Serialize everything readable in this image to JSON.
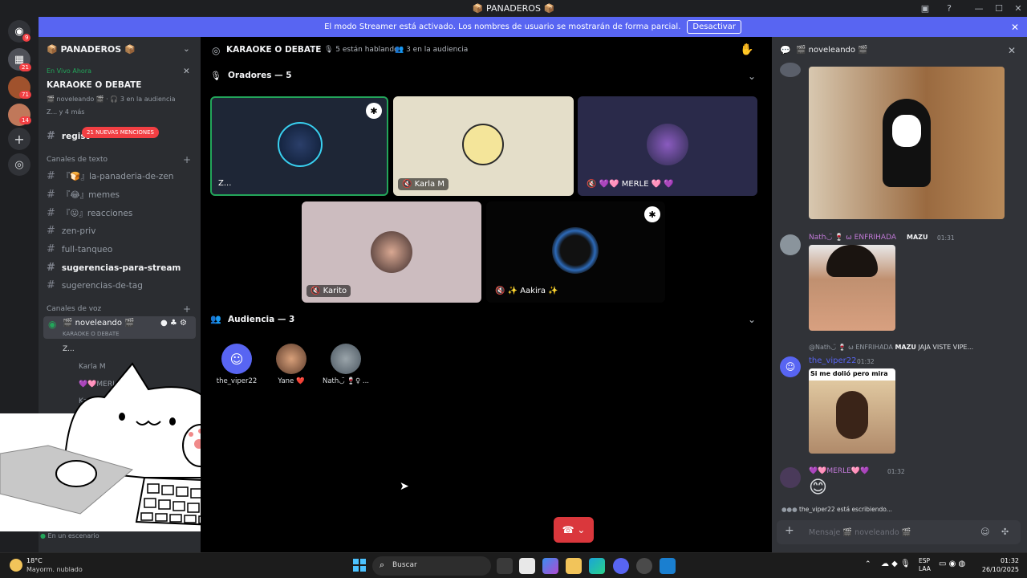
{
  "window": {
    "title": "📦 PANADEROS 📦"
  },
  "banner": {
    "text": "El modo Streamer está activado. Los nombres de usuario se mostrarán de forma parcial.",
    "button": "Desactivar"
  },
  "rail": {
    "badges": [
      "9",
      "21",
      "71",
      "14"
    ]
  },
  "server": {
    "name": "📦 PANADEROS 📦"
  },
  "live": {
    "tag": "En Vivo Ahora",
    "title": "KARAOKE O DEBATE",
    "meta": "🎬 noveleando 🎬 · 🎧 3 en la audiencia",
    "listeners": "Z... y 4 más"
  },
  "sidebar": {
    "registro": "regist",
    "mentions": "21 NUEVAS MENCIONES",
    "text_header": "Canales de texto",
    "text_channels": [
      "『🍞』la-panaderia-de-zen",
      "『😂』memes",
      "『😛』reacciones",
      "zen-priv",
      "full-tanqueo",
      "sugerencias-para-stream",
      "sugerencias-de-tag"
    ],
    "voice_header": "Canales de voz",
    "voice_channel": "🎬 noveleando 🎬",
    "voice_sub": "KARAOKE O DEBATE",
    "voice_members": [
      "Z...",
      "Karla M",
      "💜🩷MERLE",
      "Ka"
    ],
    "footer": "En un escenario"
  },
  "stage": {
    "title": "KARAOKE O DEBATE",
    "speaking": "5 están hablando",
    "audience_count": "3 en la audiencia",
    "speakers_header": "Oradores — 5",
    "speakers": [
      "Z...",
      "Karla M",
      "💜🩷 MERLE 🩷 💜",
      "Karito",
      "✨ Aakira ✨"
    ],
    "audience_header": "Audiencia — 3",
    "audience": [
      "the_viper22",
      "Yane ❤️",
      "Nath◡̈ 🍷♀ ..."
    ]
  },
  "chat": {
    "channel": "🎬 noveleando 🎬",
    "msg1_author": "Nath◡̈ 🍷 ⍵ ENFRIHADA",
    "msg1_tag": "MAZU",
    "msg1_time": "01:31",
    "reply_ref": "@Nath◡̈ 🍷 ⍵ ENFRIHADA",
    "reply_tag": "MAZU",
    "reply_text": "JAJA VISTE VIPE...",
    "msg2_author": "the_viper22",
    "msg2_time": "01:32",
    "msg2_image_text": "Si me dolió pero mira",
    "msg3_author": "💜🩷MERLE🩷💜",
    "msg3_time": "01:32",
    "msg3_emoji": "😊",
    "typing": "the_viper22 está escribiendo...",
    "input_placeholder": "Mensaje 🎬 noveleando 🎬"
  },
  "taskbar": {
    "temp": "18°C",
    "weather": "Mayorm. nublado",
    "search": "Buscar",
    "lang1": "ESP",
    "lang2": "LAA",
    "time": "01:32",
    "date": "26/10/2025"
  },
  "colors": {
    "accent": "#5865f2",
    "live": "#23a55a",
    "danger": "#da373c"
  }
}
